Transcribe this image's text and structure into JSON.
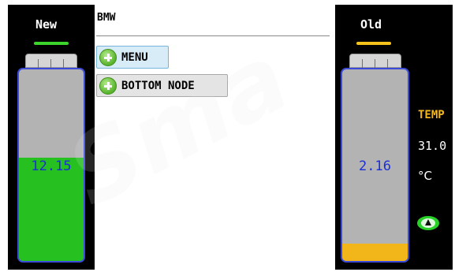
{
  "left_panel": {
    "title": "New",
    "indicator_color": "#3bd52c",
    "battery": {
      "value": "12.15",
      "fill_fraction": 0.54,
      "fill_color": "#27c021"
    }
  },
  "menu": {
    "title": "BMW",
    "items": [
      {
        "label": "MENU",
        "icon": "plus-icon",
        "selected": true
      },
      {
        "label": "BOTTOM NODE",
        "icon": "plus-icon",
        "selected": false
      }
    ]
  },
  "right_panel": {
    "title": "Old",
    "indicator_color": "#f5c21b",
    "battery": {
      "value": "2.16",
      "fill_fraction": 0.09,
      "fill_color": "#f2b51a"
    }
  },
  "temperature": {
    "label": "TEMP",
    "value": "31.0",
    "unit": "°C",
    "icon": "eye-icon",
    "icon_color": "#27d127"
  }
}
